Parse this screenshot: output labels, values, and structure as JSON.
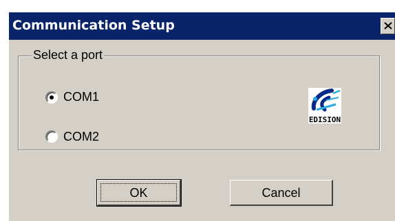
{
  "window": {
    "title": "Communication Setup",
    "titlebar_color": "#0a246a",
    "close_icon": "close-icon"
  },
  "port_group": {
    "legend": "Select a port",
    "options": [
      {
        "label": "COM1",
        "selected": true
      },
      {
        "label": "COM2",
        "selected": false
      }
    ]
  },
  "logo": {
    "text": "EDISION",
    "icon": "edision-logo-icon"
  },
  "buttons": {
    "ok_label": "OK",
    "cancel_label": "Cancel"
  }
}
